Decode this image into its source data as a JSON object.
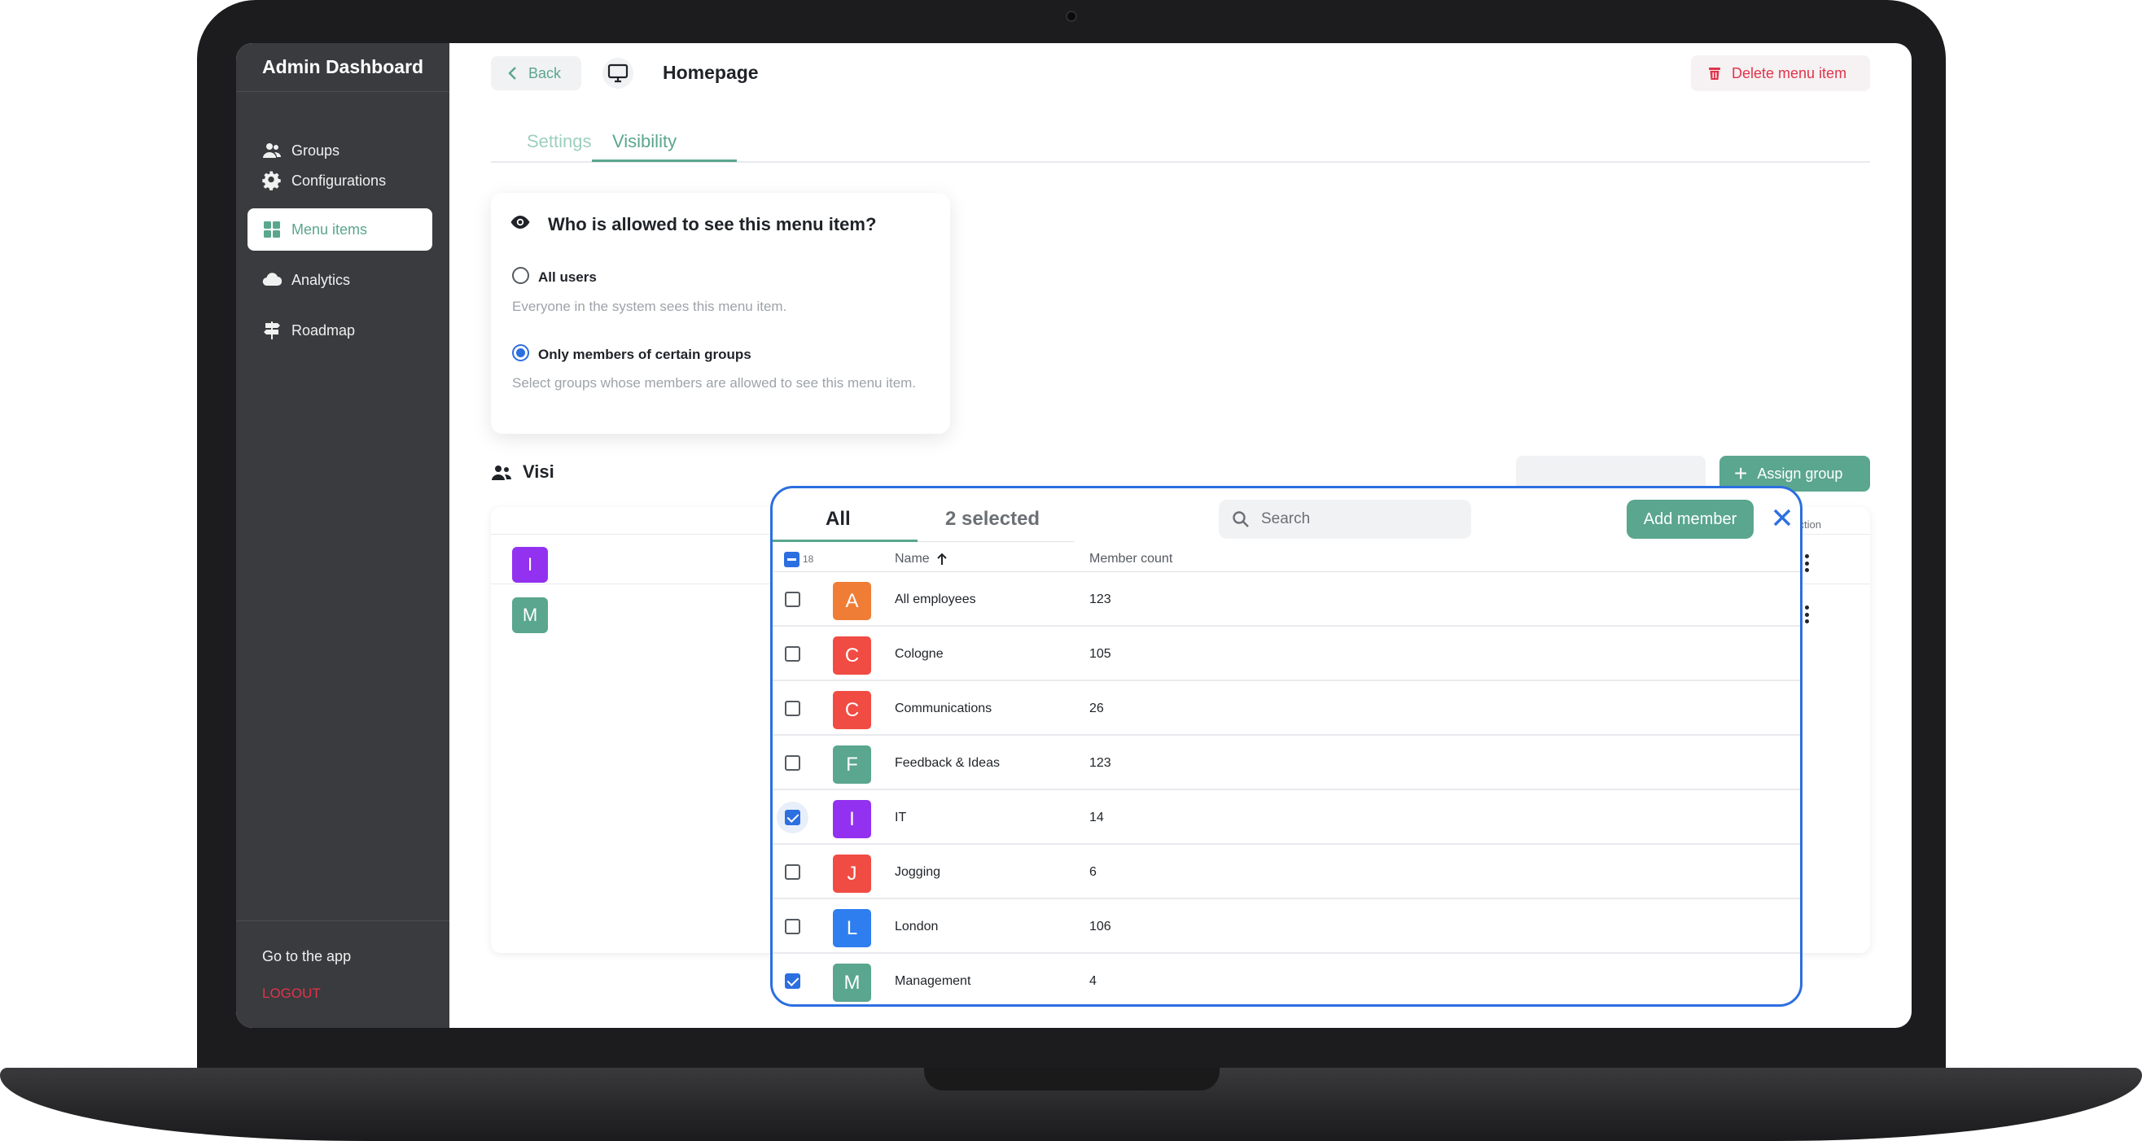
{
  "sidebar": {
    "title": "Admin Dashboard",
    "items": [
      {
        "label": "Groups",
        "icon": "users-icon"
      },
      {
        "label": "Configurations",
        "icon": "gear-icon"
      },
      {
        "label": "Menu items",
        "icon": "grid-icon",
        "active": true
      },
      {
        "label": "Analytics",
        "icon": "cloud-icon"
      },
      {
        "label": "Roadmap",
        "icon": "signpost-icon"
      }
    ],
    "go_to_app": "Go to the app",
    "logout": "LOGOUT"
  },
  "header": {
    "back_label": "Back",
    "page_title": "Homepage",
    "delete_label": "Delete menu item"
  },
  "tabs": [
    {
      "label": "Settings"
    },
    {
      "label": "Visibility",
      "active": true
    }
  ],
  "visibility": {
    "question": "Who is allowed to see this menu item?",
    "options": [
      {
        "label": "All users",
        "description": "Everyone in the system sees this menu item.",
        "selected": false
      },
      {
        "label": "Only members of certain groups",
        "description": "Select groups whose members are allowed to see this menu item.",
        "selected": true
      }
    ]
  },
  "background_table": {
    "section_label": "Visi",
    "assign_label": "Assign group",
    "select_action_label": "Select action",
    "rows": [
      {
        "initial": "I",
        "color": "#9232f0"
      },
      {
        "initial": "M",
        "color": "#5aa68e"
      }
    ]
  },
  "popup": {
    "tab_all": "All",
    "tab_selected": "2 selected",
    "search_placeholder": "Search",
    "add_member_label": "Add member",
    "header_count": "18",
    "col_name": "Name",
    "col_count": "Member count",
    "rows": [
      {
        "initial": "A",
        "name": "All employees",
        "count": "123",
        "color": "#f07d36",
        "checked": false
      },
      {
        "initial": "C",
        "name": "Cologne",
        "count": "105",
        "color": "#f04c44",
        "checked": false
      },
      {
        "initial": "C",
        "name": "Communications",
        "count": "26",
        "color": "#f04c44",
        "checked": false
      },
      {
        "initial": "F",
        "name": "Feedback & Ideas",
        "count": "123",
        "color": "#5aa68e",
        "checked": false
      },
      {
        "initial": "I",
        "name": "IT",
        "count": "14",
        "color": "#9232f0",
        "checked": true
      },
      {
        "initial": "J",
        "name": "Jogging",
        "count": "6",
        "color": "#f04c44",
        "checked": false
      },
      {
        "initial": "L",
        "name": "London",
        "count": "106",
        "color": "#2f7ef0",
        "checked": false
      },
      {
        "initial": "M",
        "name": "Management",
        "count": "4",
        "color": "#5aa68e",
        "checked": true
      }
    ]
  }
}
